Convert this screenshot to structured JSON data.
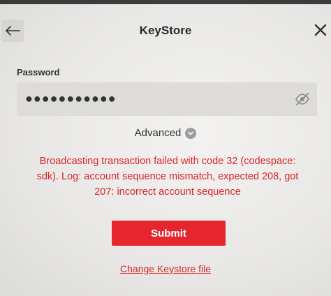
{
  "header": {
    "title": "KeyStore",
    "back_icon": "arrow-left-icon",
    "close_icon": "close-icon"
  },
  "password": {
    "label": "Password",
    "value": "●●●●●●●●●●●",
    "toggle_icon": "eye-off-icon"
  },
  "advanced": {
    "label": "Advanced",
    "icon": "chevron-down-icon"
  },
  "error": {
    "message": "Broadcasting transaction failed with code 32 (codespace: sdk). Log: account sequence mismatch, expected 208, got 207: incorrect account sequence"
  },
  "actions": {
    "submit_label": "Submit",
    "change_keystore_label": "Change Keystore file"
  },
  "colors": {
    "accent": "#e6262e",
    "error": "#d9262c"
  }
}
